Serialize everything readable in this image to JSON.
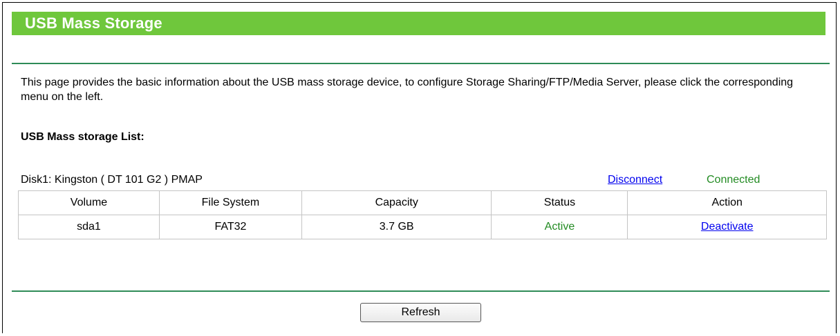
{
  "header": {
    "title": "USB Mass Storage",
    "bar_color": "#6fc73c"
  },
  "description": "This page provides the basic information about the USB mass storage device, to configure Storage Sharing/FTP/Media Server, please click the corresponding menu on the left.",
  "list_title": "USB Mass storage List:",
  "disk": {
    "name": "Disk1: Kingston ( DT 101 G2 ) PMAP",
    "action_label": "Disconnect",
    "status": "Connected",
    "status_color": "#228b22"
  },
  "table": {
    "headers": [
      "Volume",
      "File System",
      "Capacity",
      "Status",
      "Action"
    ],
    "rows": [
      {
        "volume": "sda1",
        "file_system": "FAT32",
        "capacity": "3.7 GB",
        "status": "Active",
        "action": "Deactivate"
      }
    ]
  },
  "buttons": {
    "refresh": "Refresh"
  }
}
